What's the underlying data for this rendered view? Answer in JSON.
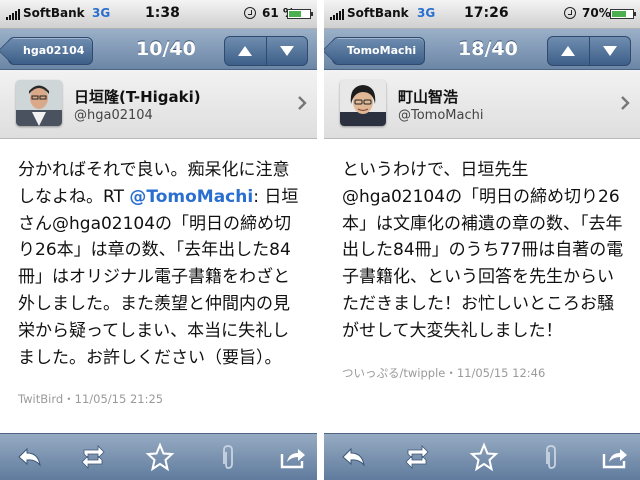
{
  "screens": [
    {
      "status_bar": {
        "carrier": "SoftBank",
        "network": "3G",
        "time": "1:38",
        "battery": "61 %",
        "battery_level": 0.61
      },
      "nav": {
        "back_label": "hga02104",
        "title": "10/40"
      },
      "user": {
        "display_name": "日垣隆(T-Higaki)",
        "screen_name": "@hga02104"
      },
      "tweet": {
        "text_before": "分かればそれで良い。痴呆化に注意しなよね。RT ",
        "mention": "@TomoMachi",
        "text_after": ": 日垣さん@hga02104の「明日の締め切り26本」は章の数、「去年出した84冊」はオリジナル電子書籍をわざと外しました。また羨望と仲間内の見栄から疑ってしまい、本当に失礼しました。お許しください（要旨）。",
        "meta": "TwitBird・11/05/15 21:25"
      },
      "toolbar": {
        "icons": [
          "reply-icon",
          "retweet-icon",
          "star-icon",
          "paperclip-icon",
          "share-icon"
        ]
      }
    },
    {
      "status_bar": {
        "carrier": "SoftBank",
        "network": "3G",
        "time": "17:26",
        "battery": "70%",
        "battery_level": 0.7
      },
      "nav": {
        "back_label": "TomoMachi",
        "title": "18/40"
      },
      "user": {
        "display_name": "町山智浩",
        "screen_name": "@TomoMachi"
      },
      "tweet": {
        "text": "というわけで、日垣先生@hga02104の「明日の締め切り26本」は文庫化の補遺の章の数、「去年出した84冊」のうち77冊は自著の電子書籍化、という回答を先生からいただきました！お忙しいところお騒がせして大変失礼しました！",
        "meta": "ついっぷる/twipple・11/05/15 12:46"
      },
      "toolbar": {
        "icons": [
          "reply-icon",
          "retweet-icon",
          "star-icon",
          "paperclip-icon",
          "share-icon"
        ]
      }
    }
  ]
}
